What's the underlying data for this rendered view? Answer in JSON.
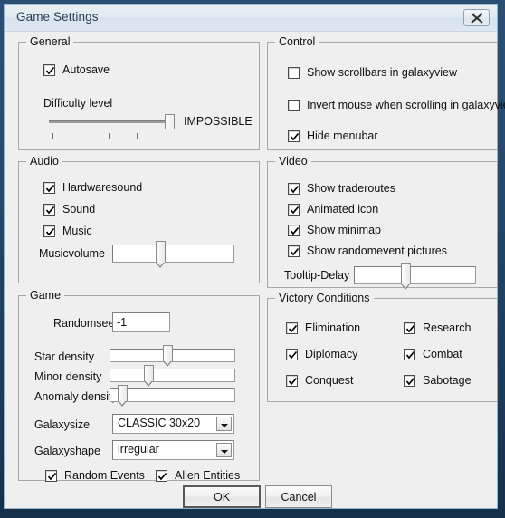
{
  "window": {
    "title": "Game Settings",
    "close_icon": "close-icon"
  },
  "groups": {
    "general": {
      "legend": "General",
      "autosave": {
        "label": "Autosave",
        "checked": true
      },
      "difficulty": {
        "label": "Difficulty level",
        "value_label": "IMPOSSIBLE",
        "position_pct": 100,
        "tick_count": 5
      }
    },
    "audio": {
      "legend": "Audio",
      "hardwaresound": {
        "label": "Hardwaresound",
        "checked": true
      },
      "sound": {
        "label": "Sound",
        "checked": true
      },
      "music": {
        "label": "Music",
        "checked": true
      },
      "musicvolume": {
        "label": "Musicvolume",
        "position_pct": 37
      }
    },
    "game": {
      "legend": "Game",
      "randomseed": {
        "label": "Randomseed",
        "value": "-1"
      },
      "star_density": {
        "label": "Star density",
        "position_pct": 45
      },
      "minor_density": {
        "label": "Minor density",
        "position_pct": 29
      },
      "anomaly_density": {
        "label": "Anomaly density",
        "position_pct": 8
      },
      "galaxysize": {
        "label": "Galaxysize",
        "value": "CLASSIC 30x20"
      },
      "galaxyshape": {
        "label": "Galaxyshape",
        "value": "irregular"
      },
      "random_events": {
        "label": "Random Events",
        "checked": true
      },
      "alien_entities": {
        "label": "Alien Entities",
        "checked": true
      }
    },
    "control": {
      "legend": "Control",
      "show_scrollbars": {
        "label": "Show scrollbars in galaxyview",
        "checked": false
      },
      "invert_mouse": {
        "label": "Invert mouse when scrolling in galaxyview",
        "checked": false
      },
      "hide_menubar": {
        "label": "Hide menubar",
        "checked": true
      }
    },
    "video": {
      "legend": "Video",
      "show_traderoutes": {
        "label": "Show traderoutes",
        "checked": true
      },
      "animated_icon": {
        "label": "Animated icon",
        "checked": true
      },
      "show_minimap": {
        "label": "Show minimap",
        "checked": true
      },
      "show_randomevent": {
        "label": "Show randomevent pictures",
        "checked": true
      },
      "tooltip_delay": {
        "label": "Tooltip-Delay",
        "position_pct": 40
      }
    },
    "victory": {
      "legend": "Victory Conditions",
      "elimination": {
        "label": "Elimination",
        "checked": true
      },
      "research": {
        "label": "Research",
        "checked": true
      },
      "diplomacy": {
        "label": "Diplomacy",
        "checked": true
      },
      "combat": {
        "label": "Combat",
        "checked": true
      },
      "conquest": {
        "label": "Conquest",
        "checked": true
      },
      "sabotage": {
        "label": "Sabotage",
        "checked": true
      }
    }
  },
  "footer": {
    "ok": "OK",
    "cancel": "Cancel"
  },
  "colors": {
    "window_frame": "#1d3c5c",
    "dialog_bg": "#efefef",
    "titlebar": "#e2eaf2",
    "text": "#111111",
    "group_border": "#a8a8a8"
  }
}
